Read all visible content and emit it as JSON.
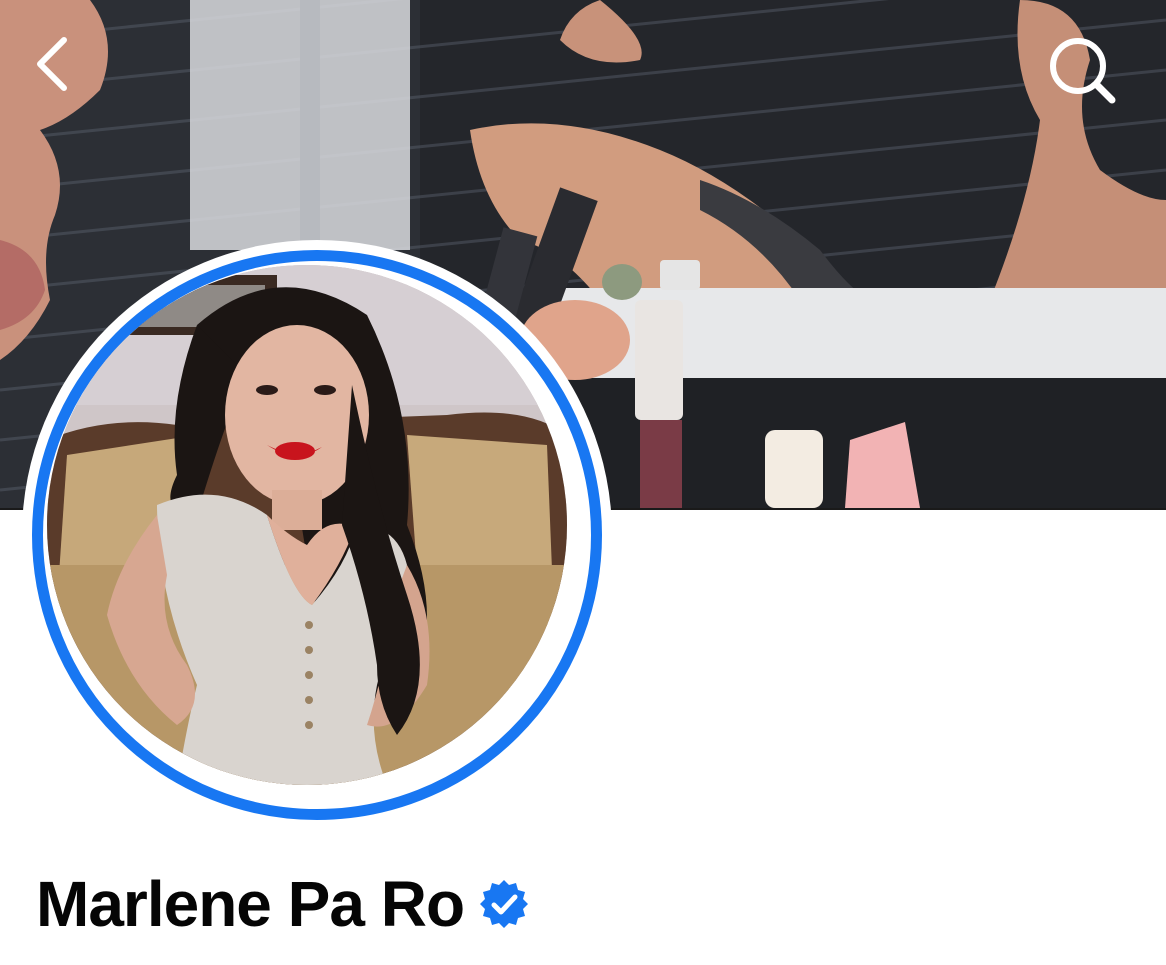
{
  "profile": {
    "name": "Marlene Pa Ro",
    "verified": true
  },
  "header": {
    "back_icon": "chevron-left-icon",
    "search_icon": "search-icon"
  },
  "colors": {
    "accent": "#1877f2",
    "text_primary": "#050505",
    "background": "#ffffff"
  }
}
